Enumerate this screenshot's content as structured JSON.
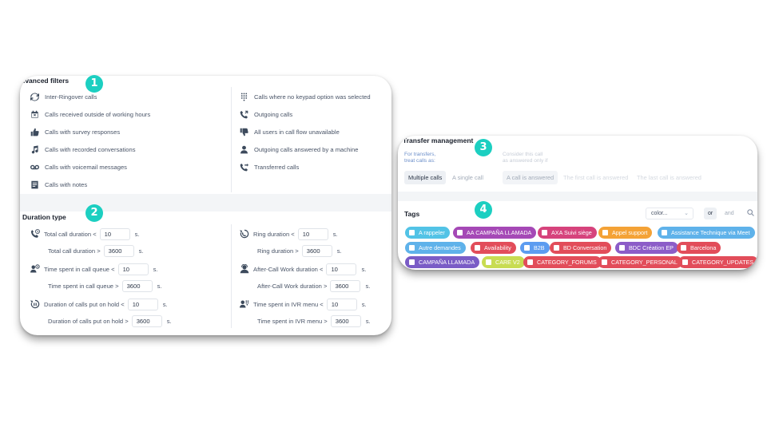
{
  "advanced_filters": {
    "title": "Advanced filters",
    "left_items": [
      {
        "label": "Inter-Ringover calls",
        "icon": "sync-icon"
      },
      {
        "label": "Calls received outside of working hours",
        "icon": "calendar-x-icon"
      },
      {
        "label": "Calls with survey responses",
        "icon": "thumbs-up-icon"
      },
      {
        "label": "Calls with recorded conversations",
        "icon": "music-note-icon"
      },
      {
        "label": "Calls with voicemail messages",
        "icon": "voicemail-icon"
      },
      {
        "label": "Calls with notes",
        "icon": "note-icon"
      }
    ],
    "right_items": [
      {
        "label": "Calls where no keypad option was selected",
        "icon": "keypad-icon"
      },
      {
        "label": "Outgoing calls",
        "icon": "outgoing-call-icon"
      },
      {
        "label": "All users in call flow unavailable",
        "icon": "thumbs-down-icon"
      },
      {
        "label": "Outgoing calls answered by a machine",
        "icon": "user-icon"
      },
      {
        "label": "Transferred calls",
        "icon": "transfer-call-icon"
      }
    ]
  },
  "duration_type": {
    "title": "Duration type",
    "unit": "s.",
    "left_rows": [
      {
        "label": "Total call duration <",
        "value": "10",
        "icon": "phone-clock-icon"
      },
      {
        "label": "Total call duration >",
        "value": "3600"
      },
      {
        "label": "Time spent in call queue <",
        "value": "10",
        "icon": "queue-icon"
      },
      {
        "label": "Time spent in call queue >",
        "value": "3600"
      },
      {
        "label": "Duration of calls put on hold <",
        "value": "10",
        "icon": "hold-icon"
      },
      {
        "label": "Duration of calls put on hold >",
        "value": "3600"
      }
    ],
    "right_rows": [
      {
        "label": "Ring duration <",
        "value": "10",
        "icon": "ring-icon"
      },
      {
        "label": "Ring duration >",
        "value": "3600"
      },
      {
        "label": "After-Call Work duration <",
        "value": "10",
        "icon": "after-call-icon"
      },
      {
        "label": "After-Call Work duration >",
        "value": "3600"
      },
      {
        "label": "Time spent in IVR menu <",
        "value": "10",
        "icon": "ivr-icon"
      },
      {
        "label": "Time spent in IVR menu >",
        "value": "3600"
      }
    ]
  },
  "transfer_management": {
    "title": "Transfer management",
    "treat_label_1": "For transfers,",
    "treat_label_2": "treat calls as:",
    "consider_label_1": "Consider this call",
    "consider_label_2": "as answered only if",
    "option_multiple": "Multiple calls",
    "option_single": "A single call",
    "option_answered": "A call is answered",
    "option_first": "The first call is answered",
    "option_last": "The last call is answered"
  },
  "tags": {
    "title": "Tags",
    "color_select": "color...",
    "logic_or": "or",
    "logic_and": "and",
    "items": [
      {
        "label": "A rappeler",
        "color": "#52c3e6"
      },
      {
        "label": "AA CAMPAÑA LLAMADA",
        "color": "#a549b6"
      },
      {
        "label": "AXA Suivi siège",
        "color": "#d6437c"
      },
      {
        "label": "Appel support",
        "color": "#f4a236"
      },
      {
        "label": "Assistance Technique via Meet",
        "color": "#5fb2ea"
      },
      {
        "label": "Autre demandes",
        "color": "#5fb2ea"
      },
      {
        "label": "Availability",
        "color": "#e24d5a"
      },
      {
        "label": "B2B",
        "color": "#5c9cf0"
      },
      {
        "label": "BD Conversation",
        "color": "#e24d5a"
      },
      {
        "label": "BDC Création EP",
        "color": "#8c5dc8"
      },
      {
        "label": "Barcelona",
        "color": "#e24d5a"
      },
      {
        "label": "CAMPAÑA LLAMADA",
        "color": "#7a5cc6"
      },
      {
        "label": "CARE V2",
        "color": "#c8dc52"
      },
      {
        "label": "CATEGORY_FORUMS",
        "color": "#e24d5a"
      },
      {
        "label": "CATEGORY_PERSONAL",
        "color": "#e24d5a"
      },
      {
        "label": "CATEGORY_UPDATES",
        "color": "#e24d5a"
      }
    ]
  },
  "badges": [
    "1",
    "2",
    "3",
    "4"
  ]
}
